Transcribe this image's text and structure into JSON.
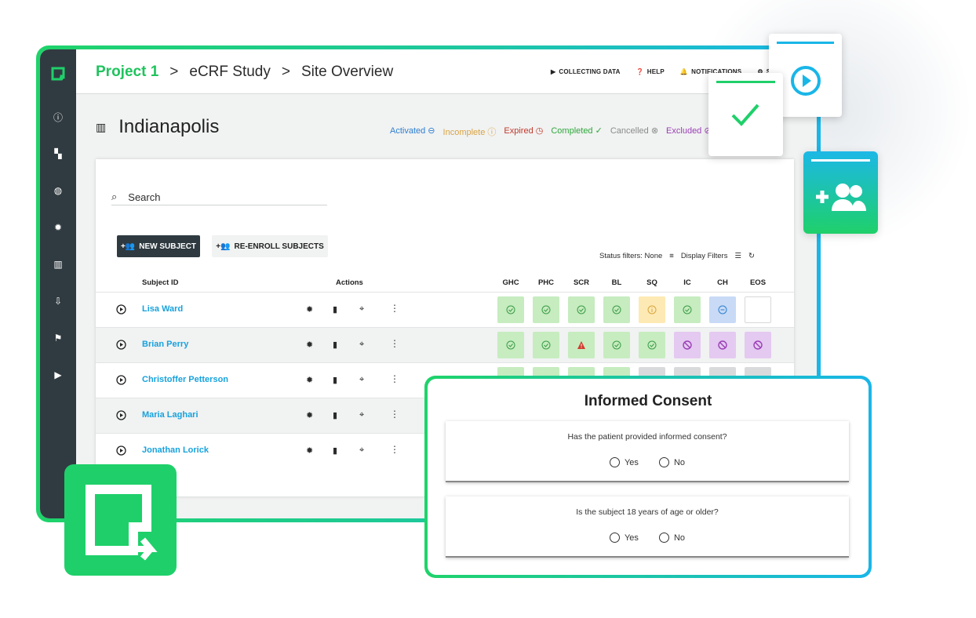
{
  "breadcrumb": {
    "project": "Project 1",
    "study": "eCRF Study",
    "page": "Site Overview",
    "separator": ">"
  },
  "top_actions": [
    {
      "label": "COLLECTING DATA",
      "icon": "play-icon"
    },
    {
      "label": "HELP",
      "icon": "help-icon"
    },
    {
      "label": "NOTIFICATIONS",
      "icon": "bell-icon"
    },
    {
      "label": "SA",
      "icon": "settings-icon"
    }
  ],
  "site": {
    "name": "Indianapolis",
    "icon": "building-icon"
  },
  "legend": [
    {
      "label": "Activated",
      "color": "#2e7fd0",
      "glyph": "⊖"
    },
    {
      "label": "Incomplete",
      "color": "#d9a441",
      "glyph": "ⓘ"
    },
    {
      "label": "Expired",
      "color": "#c0392b",
      "glyph": "◷"
    },
    {
      "label": "Completed",
      "color": "#2da83a",
      "glyph": "✓"
    },
    {
      "label": "Cancelled",
      "color": "#8a8a8a",
      "glyph": "⊗"
    },
    {
      "label": "Excluded",
      "color": "#9b3fb5",
      "glyph": "⊘"
    }
  ],
  "search": {
    "placeholder": "Search"
  },
  "buttons": {
    "new_subject": "NEW SUBJECT",
    "re_enroll": "RE-ENROLL SUBJECTS"
  },
  "filters": {
    "status": "Status filters: None",
    "display": "Display Filters"
  },
  "columns": {
    "subject_id": "Subject ID",
    "actions": "Actions",
    "visits": [
      "GHC",
      "PHC",
      "SCR",
      "BL",
      "SQ",
      "IC",
      "CH",
      "EOS"
    ]
  },
  "rows": [
    {
      "name": "Lisa Ward",
      "status": [
        "completed",
        "completed",
        "completed",
        "completed",
        "incomplete",
        "completed",
        "activated",
        "empty"
      ]
    },
    {
      "name": "Brian Perry",
      "status": [
        "completed",
        "completed",
        "warning",
        "completed",
        "completed",
        "excluded",
        "excluded",
        "excluded"
      ]
    },
    {
      "name": "Christoffer Petterson",
      "status": [
        "completed",
        "completed",
        "completed",
        "completed",
        "gray",
        "gray",
        "gray",
        "gray"
      ]
    },
    {
      "name": "Maria Laghari",
      "status": []
    },
    {
      "name": "Jonathan Lorick",
      "status": []
    }
  ],
  "consent": {
    "title": "Informed Consent",
    "questions": [
      {
        "text": "Has the patient provided informed consent?",
        "yes": "Yes",
        "no": "No"
      },
      {
        "text": "Is the subject 18 years of age or older?",
        "yes": "Yes",
        "no": "No"
      }
    ]
  },
  "colors": {
    "brand_green": "#1fd06a",
    "brand_blue": "#19b6e8",
    "sidebar": "#303b41",
    "link": "#17a2dd"
  }
}
